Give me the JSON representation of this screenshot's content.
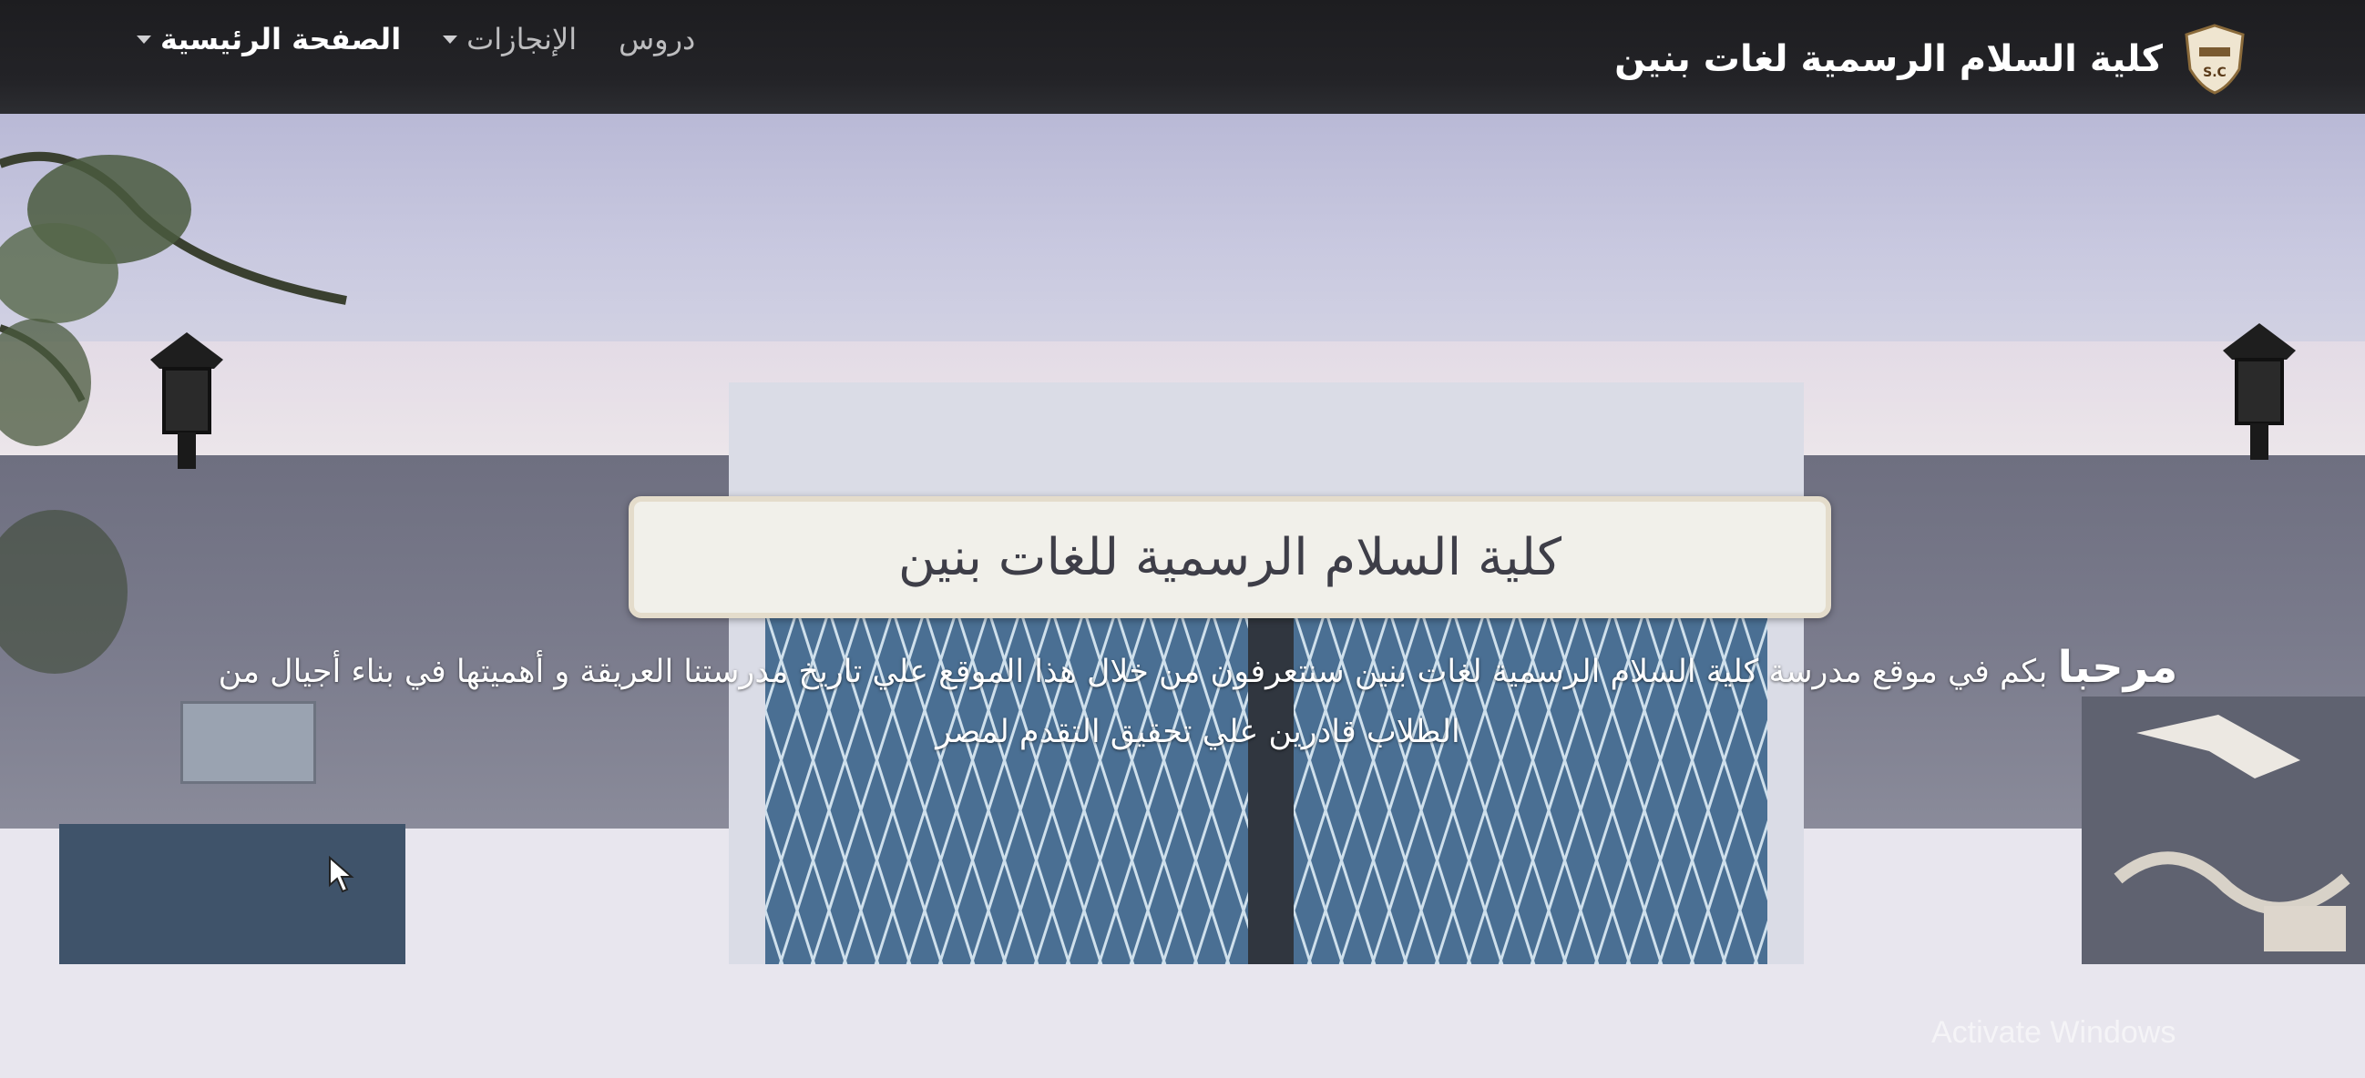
{
  "navbar": {
    "brand_name": "كلية السلام الرسمية لغات بنين",
    "logo_text": "S.C",
    "menu": [
      {
        "label": "الصفحة الرئيسية",
        "has_dropdown": true
      },
      {
        "label": "الإنجازات",
        "has_dropdown": true
      },
      {
        "label": "دروس",
        "has_dropdown": false
      }
    ]
  },
  "hero": {
    "title": "كلية السلام الرسمية للغات بنين",
    "welcome_word": "مرحبا",
    "welcome_text": "بكم في موقع مدرسة كلية السلام الرسمية لغات بنين سنتعرفون من خلال هذا الموقع علي تاريخ مدرستنا العريقة و أهميتها في بناء أجيال من الطلاب قادرين علي تحقيق التقدم لمصر"
  },
  "overlay": {
    "watermark": "Activate Windows"
  },
  "colors": {
    "navbar_bg": "#232327",
    "title_box_bg": "#f1f0ea",
    "hero_text": "#ffffff"
  }
}
